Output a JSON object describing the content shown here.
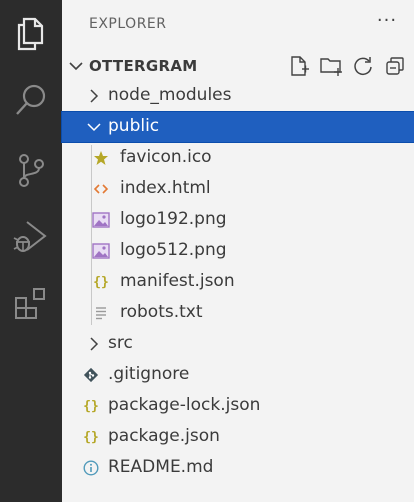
{
  "explorer": {
    "title": "EXPLORER",
    "more_label": "···",
    "folder_name": "OTTERGRAM"
  },
  "activity_bar": {
    "items": [
      {
        "icon": "files-icon",
        "active": true
      },
      {
        "icon": "search-icon",
        "active": false
      },
      {
        "icon": "source-control-icon",
        "active": false
      },
      {
        "icon": "run-debug-icon",
        "active": false
      },
      {
        "icon": "extensions-icon",
        "active": false
      }
    ]
  },
  "section_actions": [
    "new-file-icon",
    "new-folder-icon",
    "refresh-icon",
    "collapse-all-icon"
  ],
  "tree": [
    {
      "label": "node_modules",
      "type": "folder",
      "expanded": false,
      "depth": 0
    },
    {
      "label": "public",
      "type": "folder",
      "expanded": true,
      "depth": 0,
      "selected": true
    },
    {
      "label": "favicon.ico",
      "type": "file",
      "icon": "star-icon",
      "depth": 1
    },
    {
      "label": "index.html",
      "type": "file",
      "icon": "html-icon",
      "depth": 1
    },
    {
      "label": "logo192.png",
      "type": "file",
      "icon": "image-icon",
      "depth": 1
    },
    {
      "label": "logo512.png",
      "type": "file",
      "icon": "image-icon",
      "depth": 1
    },
    {
      "label": "manifest.json",
      "type": "file",
      "icon": "json-icon",
      "depth": 1
    },
    {
      "label": "robots.txt",
      "type": "file",
      "icon": "text-file-icon",
      "depth": 1
    },
    {
      "label": "src",
      "type": "folder",
      "expanded": false,
      "depth": 0
    },
    {
      "label": ".gitignore",
      "type": "file",
      "icon": "git-icon",
      "depth": 0
    },
    {
      "label": "package-lock.json",
      "type": "file",
      "icon": "json-icon",
      "depth": 0
    },
    {
      "label": "package.json",
      "type": "file",
      "icon": "json-icon",
      "depth": 0
    },
    {
      "label": "README.md",
      "type": "file",
      "icon": "info-icon",
      "depth": 0
    }
  ],
  "colors": {
    "activity_bar": "#2c2c2c",
    "sidebar": "#f3f3f3",
    "selection": "#1f5fbf",
    "json": "#b5a727",
    "html": "#e37933",
    "image": "#a074c4",
    "star": "#cbcb41",
    "info": "#519aba"
  }
}
